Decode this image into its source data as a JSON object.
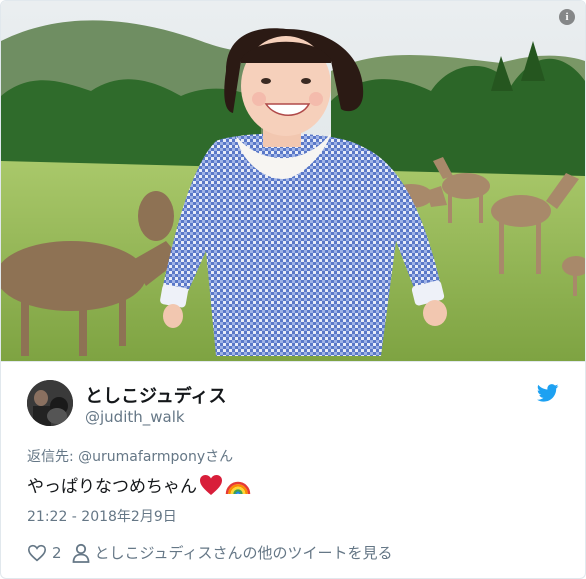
{
  "tweet": {
    "display_name": "としこジュディス",
    "username": "@judith_walk",
    "reply_label": "返信先:",
    "reply_handle": "@urumafarmponyさん",
    "text": "やっぱりなつめちゃん",
    "timestamp": "21:22 - 2018年2月9日",
    "like_count": "2",
    "more_tweets_label": "としこジュディスさんの他のツイートを見る"
  },
  "icons": {
    "info": "info-icon",
    "bird": "twitter-bird-icon",
    "heart": "heart-icon",
    "rainbow": "rainbow-icon",
    "person": "person-icon"
  },
  "colors": {
    "brand": "#1da1f2",
    "heart_emoji": "#d81e3a",
    "secondary_text": "#657786"
  }
}
